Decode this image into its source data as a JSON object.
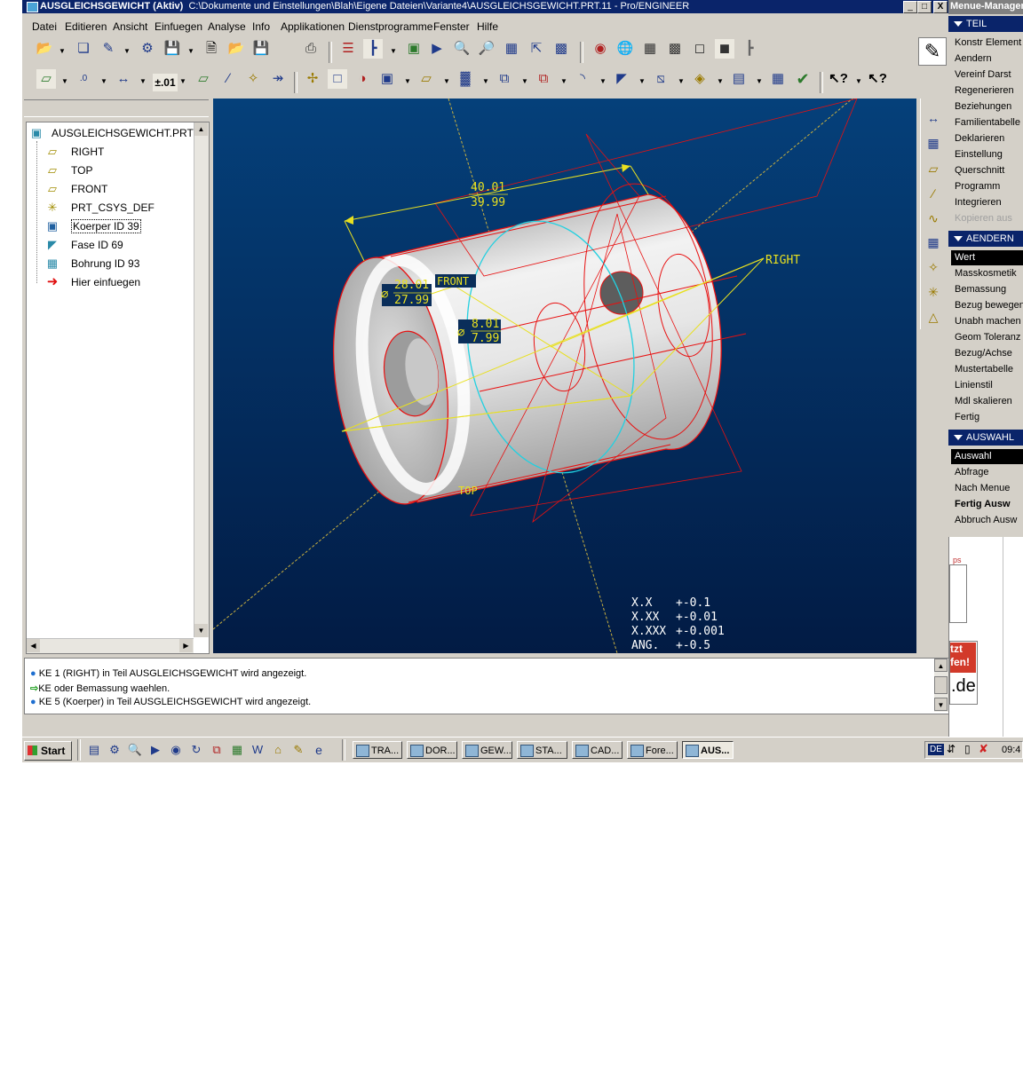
{
  "window": {
    "title_bold": "AUSGLEICHSGEWICHT (Aktiv)",
    "title_path": "C:\\Dokumente und Einstellungen\\Blah\\Eigene Dateien\\Variante4\\AUSGLEICHSGEWICHT.PRT.11 - Pro/ENGINEER",
    "min": "_",
    "max": "□",
    "close": "X"
  },
  "menubar": [
    "Datei",
    "Editieren",
    "Ansicht",
    "Einfuegen",
    "Analyse",
    "Info",
    "Applikationen",
    "Dienstprogramme",
    "Fenster",
    "Hilfe"
  ],
  "toolbar": {
    "tolerance_label": "±.01"
  },
  "tree": {
    "root": "AUSGLEICHSGEWICHT.PRT",
    "items": [
      "RIGHT",
      "TOP",
      "FRONT",
      "PRT_CSYS_DEF",
      "Koerper ID 39",
      "Fase ID 69",
      "Bohrung ID 93",
      "Hier einfuegen"
    ]
  },
  "viewport": {
    "bg_top": "#05407a",
    "bg_bottom": "#021b44",
    "dim_length_upper": "40.01",
    "dim_length_lower": "39.99",
    "dim_dia_outer_upper": "28.01",
    "dim_dia_outer_lower": "27.99",
    "dim_dia_inner_upper": "8.01",
    "dim_dia_inner_lower": "7.99",
    "diameter_symbol": "⌀",
    "plane_right": "RIGHT",
    "plane_front": "FRONT",
    "plane_top": "TOP",
    "tolerance_table": [
      {
        "label": "X.X",
        "value": "+-0.1"
      },
      {
        "label": "X.XX",
        "value": "+-0.01"
      },
      {
        "label": "X.XXX",
        "value": "+-0.001"
      },
      {
        "label": "ANG.",
        "value": "+-0.5"
      }
    ]
  },
  "messages": [
    "KE 1 (RIGHT) in Teil AUSGLEICHSGEWICHT wird angezeigt.",
    "KE oder Bemassung waehlen.",
    "KE 5 (Koerper) in Teil AUSGLEICHSGEWICHT wird angezeigt."
  ],
  "menu_manager": {
    "title": "Menue-Manager",
    "sections": [
      {
        "header": "TEIL",
        "items": [
          "Konstr Element",
          "Aendern",
          "Vereinf Darst",
          "Regenerieren",
          "Beziehungen",
          "Familientabelle",
          "Deklarieren",
          "Einstellung",
          "Querschnitt",
          "Programm",
          "Integrieren",
          "Kopieren aus"
        ]
      },
      {
        "header": "AENDERN",
        "items": [
          "Wert",
          "Masskosmetik",
          "Bemassung",
          "Bezug bewegen",
          "Unabh machen",
          "Geom Toleranz",
          "Bezug/Achse",
          "Mustertabelle",
          "Linienstil",
          "Mdl skalieren",
          "Fertig"
        ]
      },
      {
        "header": "AUSWAHL",
        "items": [
          "Auswahl",
          "Abfrage",
          "Nach Menue",
          "Fertig Ausw",
          "Abbruch Ausw"
        ]
      }
    ]
  },
  "taskbar": {
    "start": "Start",
    "tasks": [
      "TRA...",
      "DOR...",
      "GEW...",
      "STA...",
      "CAD...",
      "Fore...",
      "AUS..."
    ],
    "lang": "DE",
    "clock": "09:4"
  },
  "background_ad": {
    "line1": "tzt",
    "line2": "fen!",
    "line3": ".de",
    "tiny": "ps"
  }
}
